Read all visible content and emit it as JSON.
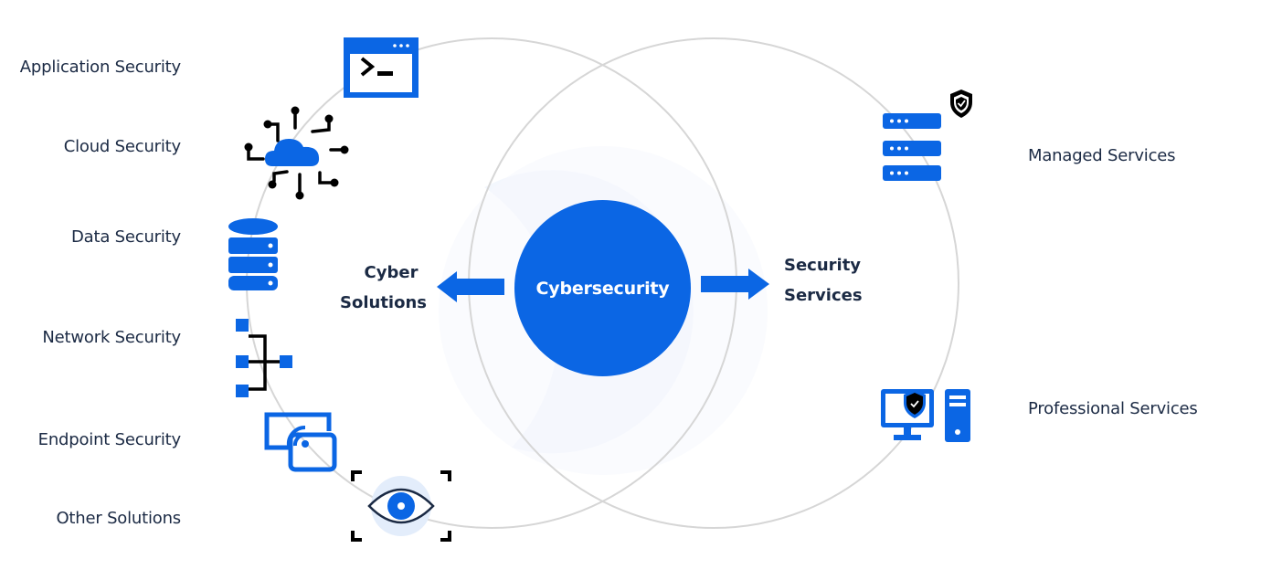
{
  "colors": {
    "primary_blue": "#0b66e4",
    "dark_text": "#1b2a44",
    "ring_gray": "#d4d4d4",
    "halo_blue": "#f3f7fd",
    "icon_black": "#000000"
  },
  "center": {
    "label": "Cybersecurity"
  },
  "left_branch": {
    "title_line1": "Cyber",
    "title_line2": "Solutions",
    "arrow_direction": "left",
    "items": [
      {
        "label": "Application Security",
        "icon": "terminal-window-icon"
      },
      {
        "label": "Cloud Security",
        "icon": "cloud-network-icon"
      },
      {
        "label": "Data Security",
        "icon": "database-icon"
      },
      {
        "label": "Network Security",
        "icon": "network-topology-icon"
      },
      {
        "label": "Endpoint Security",
        "icon": "wireless-devices-icon"
      },
      {
        "label": "Other Solutions",
        "icon": "eye-scan-icon"
      }
    ]
  },
  "right_branch": {
    "title_line1": "Security",
    "title_line2": "Services",
    "arrow_direction": "right",
    "items": [
      {
        "label": "Managed Services",
        "icon": "server-shield-icon"
      },
      {
        "label": "Professional Services",
        "icon": "computer-shield-icon"
      }
    ]
  }
}
